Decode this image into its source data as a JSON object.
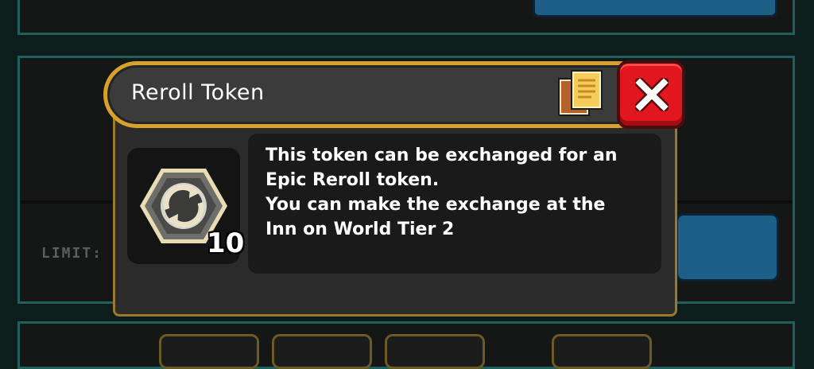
{
  "popup": {
    "title": "Reroll Token",
    "item_count": "10",
    "description_lines": [
      "This token can be exchanged for an",
      "Epic Reroll token.",
      "You can make the exchange at the",
      "Inn on World Tier 2"
    ]
  },
  "background": {
    "limit_label": "LIMIT:"
  },
  "icons": {
    "copy": "copy-documents-icon",
    "close": "close-x-icon",
    "item": "reroll-token-icon"
  },
  "colors": {
    "header_border": "#d7a12c",
    "close_button": "#e2161e",
    "panel_border": "#1f5f5e"
  }
}
